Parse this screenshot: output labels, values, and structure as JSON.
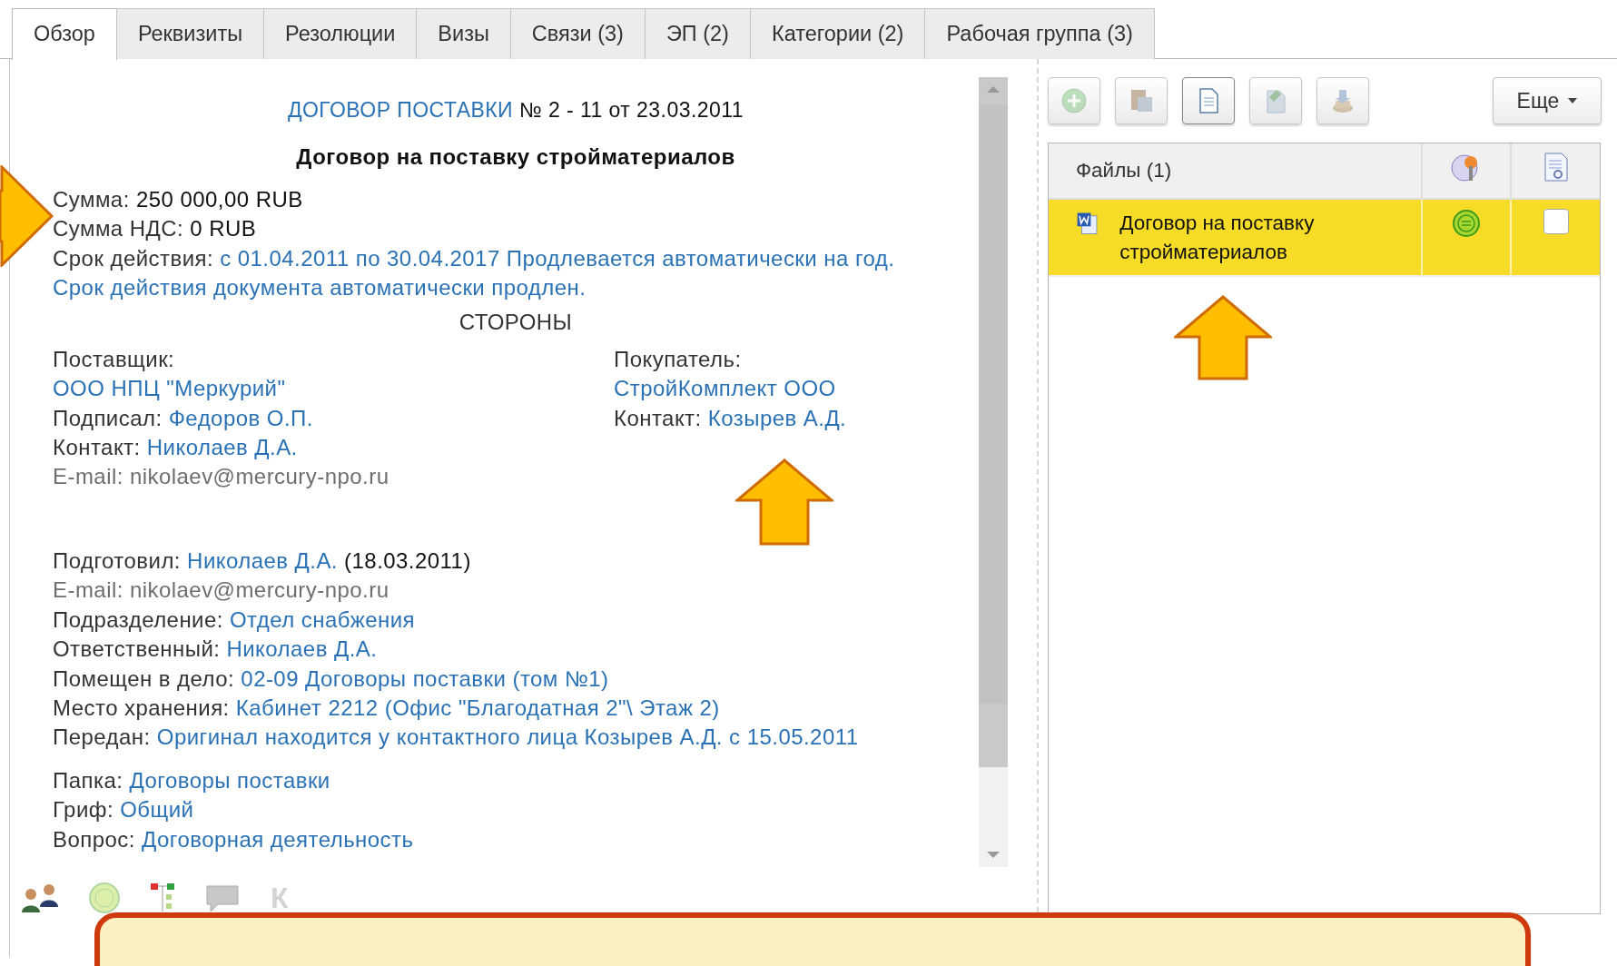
{
  "tabs": [
    {
      "label": "Обзор",
      "selected": true
    },
    {
      "label": "Реквизиты",
      "selected": false
    },
    {
      "label": "Резолюции",
      "selected": false
    },
    {
      "label": "Визы",
      "selected": false
    },
    {
      "label": "Связи (3)",
      "selected": false
    },
    {
      "label": "ЭП (2)",
      "selected": false
    },
    {
      "label": "Категории (2)",
      "selected": false
    },
    {
      "label": "Рабочая группа (3)",
      "selected": false
    }
  ],
  "document": {
    "kind_link": "ДОГОВОР ПОСТАВКИ",
    "number": "№ 2 - 11 от 23.03.2011",
    "subject": "Договор на поставку стройматериалов",
    "summary": [
      {
        "label": "Сумма:",
        "value": "250 000,00 RUB",
        "kind": "plain"
      },
      {
        "label": "Сумма НДС:",
        "value": "0 RUB",
        "kind": "plain"
      },
      {
        "label": "Срок действия:",
        "value": "с 01.04.2011 по 30.04.2017 Продлевается автоматически на год.",
        "kind": "link"
      },
      {
        "value": "Срок действия документа автоматически продлен.",
        "kind": "link"
      }
    ],
    "parties_title": "СТОРОНЫ",
    "supplier": [
      {
        "label": "Поставщик:",
        "kind": "label"
      },
      {
        "value": "ООО НПЦ \"Меркурий\"",
        "kind": "link"
      },
      {
        "label": "Подписал:",
        "value": "Федоров О.П.",
        "kind": "link"
      },
      {
        "label": "Контакт:",
        "value": "Николаев Д.А.",
        "kind": "link"
      },
      {
        "label": "E-mail:",
        "value": "nikolaev@mercury-npo.ru",
        "kind": "muted"
      }
    ],
    "buyer": [
      {
        "label": "Покупатель:",
        "kind": "label"
      },
      {
        "value": "СтройКомплект ООО",
        "kind": "link"
      },
      {
        "label": "Контакт:",
        "value": "Козырев А.Д.",
        "kind": "link"
      }
    ],
    "registration": [
      {
        "label": "Подготовил:",
        "value": "Николаев Д.А.",
        "suffix": "(18.03.2011)",
        "kind": "link"
      },
      {
        "label": "E-mail:",
        "value": "nikolaev@mercury-npo.ru",
        "kind": "muted"
      },
      {
        "label": "Подразделение:",
        "value": "Отдел снабжения",
        "kind": "link"
      },
      {
        "label": "Ответственный:",
        "value": "Николаев Д.А.",
        "kind": "link"
      },
      {
        "label": "Помещен в дело:",
        "value": "02-09 Договоры поставки (том №1)",
        "kind": "link"
      },
      {
        "label": "Место хранения:",
        "value": "Кабинет 2212 (Офис \"Благодатная 2\"\\ Этаж 2)",
        "kind": "link"
      },
      {
        "label": "Передан:",
        "value": "Оригинал находится у контактного лица Козырев А.Д. с 15.05.2011",
        "kind": "link"
      }
    ],
    "classification": [
      {
        "label": "Папка:",
        "value": "Договоры поставки",
        "kind": "link"
      },
      {
        "label": "Гриф:",
        "value": "Общий",
        "kind": "link"
      },
      {
        "label": "Вопрос:",
        "value": "Договорная деятельность",
        "kind": "link"
      }
    ]
  },
  "bottom_icons": [
    {
      "kind": "people"
    },
    {
      "kind": "status"
    },
    {
      "kind": "flags"
    },
    {
      "kind": "comment"
    },
    {
      "kind": "letter",
      "text": "К"
    }
  ],
  "toolbar": [
    {
      "kind": "add",
      "disabled": true
    },
    {
      "kind": "paste",
      "disabled": true
    },
    {
      "kind": "document",
      "disabled": false
    },
    {
      "kind": "edit",
      "disabled": true
    },
    {
      "kind": "stamp",
      "disabled": true
    }
  ],
  "more_button": "Еще",
  "files": {
    "header": "Файлы (1)",
    "rows": [
      {
        "name": "Договор на поставку стройматериалов",
        "selected": true,
        "checked": false
      }
    ]
  }
}
